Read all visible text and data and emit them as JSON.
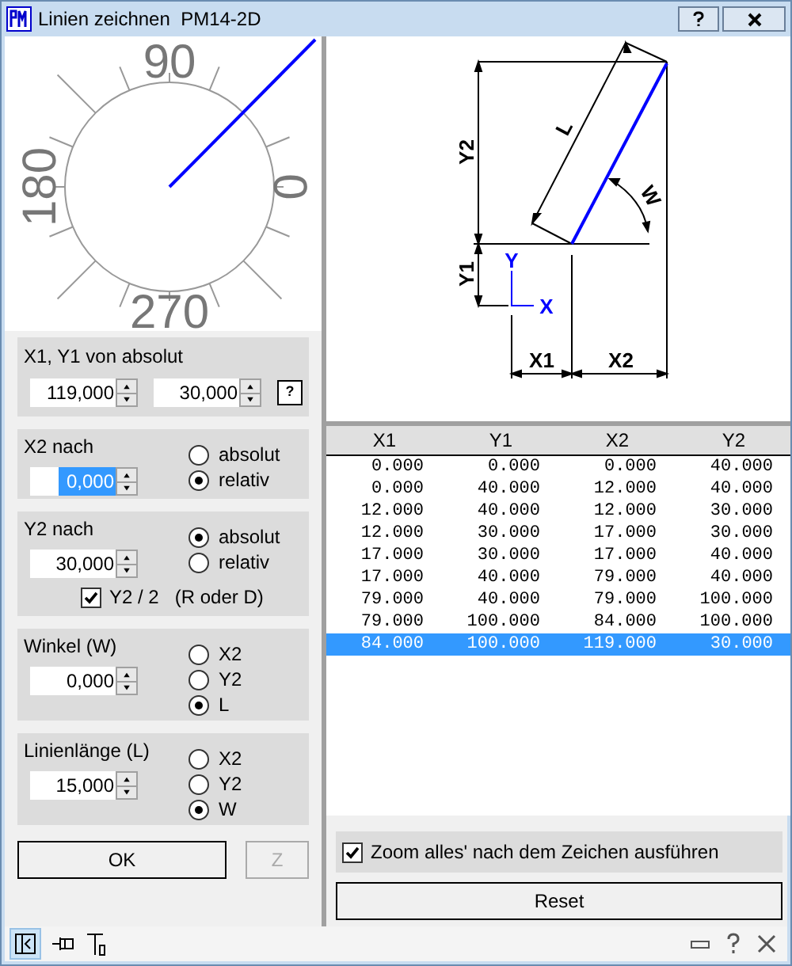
{
  "window": {
    "title": "Linien zeichnen  PM14-2D"
  },
  "dial": {
    "labels": [
      "90",
      "180",
      "0",
      "270"
    ]
  },
  "start": {
    "title": "X1, Y1 von absolut",
    "fields": [
      {
        "value": "119,000",
        "text_selected": false
      },
      {
        "value": "30,000",
        "text_selected": false
      }
    ],
    "help": "?"
  },
  "groups": [
    {
      "title": "X2 nach",
      "field": {
        "value": "0,000",
        "text_selected": true
      },
      "options": [
        {
          "label": "absolut",
          "selected": false
        },
        {
          "label": "relativ",
          "selected": true
        }
      ]
    },
    {
      "title": "Y2 nach",
      "field": {
        "value": "30,000",
        "text_selected": false
      },
      "options": [
        {
          "label": "absolut",
          "selected": true
        },
        {
          "label": "relativ",
          "selected": false
        }
      ],
      "checkbox": {
        "label": "Y2 / 2   (R oder D)",
        "checked": true
      }
    },
    {
      "title": "Winkel (W)",
      "field": {
        "value": "0,000",
        "text_selected": false
      },
      "options": [
        {
          "label": "X2",
          "selected": false
        },
        {
          "label": "Y2",
          "selected": false
        },
        {
          "label": "L",
          "selected": true
        }
      ]
    },
    {
      "title": "Linienlänge (L)",
      "field": {
        "value": "15,000",
        "text_selected": false
      },
      "options": [
        {
          "label": "X2",
          "selected": false
        },
        {
          "label": "Y2",
          "selected": false
        },
        {
          "label": "W",
          "selected": true
        }
      ]
    }
  ],
  "buttons": [
    {
      "label": "OK",
      "disabled": false
    },
    {
      "label": "Z",
      "disabled": true
    }
  ],
  "diagram": {
    "labels": {
      "y2": "Y2",
      "l": "L",
      "w": "W",
      "y1": "Y1",
      "y": "Y",
      "x": "X",
      "x1": "X1",
      "x2": "X2"
    }
  },
  "table": {
    "columns": [
      "X1",
      "Y1",
      "X2",
      "Y2"
    ],
    "rows": [
      {
        "cells": [
          "0.000",
          "0.000",
          "0.000",
          "40.000"
        ],
        "selected": false
      },
      {
        "cells": [
          "0.000",
          "40.000",
          "12.000",
          "40.000"
        ],
        "selected": false
      },
      {
        "cells": [
          "12.000",
          "40.000",
          "12.000",
          "30.000"
        ],
        "selected": false
      },
      {
        "cells": [
          "12.000",
          "30.000",
          "17.000",
          "30.000"
        ],
        "selected": false
      },
      {
        "cells": [
          "17.000",
          "30.000",
          "17.000",
          "40.000"
        ],
        "selected": false
      },
      {
        "cells": [
          "17.000",
          "40.000",
          "79.000",
          "40.000"
        ],
        "selected": false
      },
      {
        "cells": [
          "79.000",
          "40.000",
          "79.000",
          "100.000"
        ],
        "selected": false
      },
      {
        "cells": [
          "79.000",
          "100.000",
          "84.000",
          "100.000"
        ],
        "selected": false
      },
      {
        "cells": [
          "84.000",
          "100.000",
          "119.000",
          "30.000"
        ],
        "selected": true
      }
    ]
  },
  "zoom_option": {
    "label": "Zoom alles' nach dem Zeichen ausführen",
    "checked": true
  },
  "reset": {
    "label": "Reset"
  }
}
